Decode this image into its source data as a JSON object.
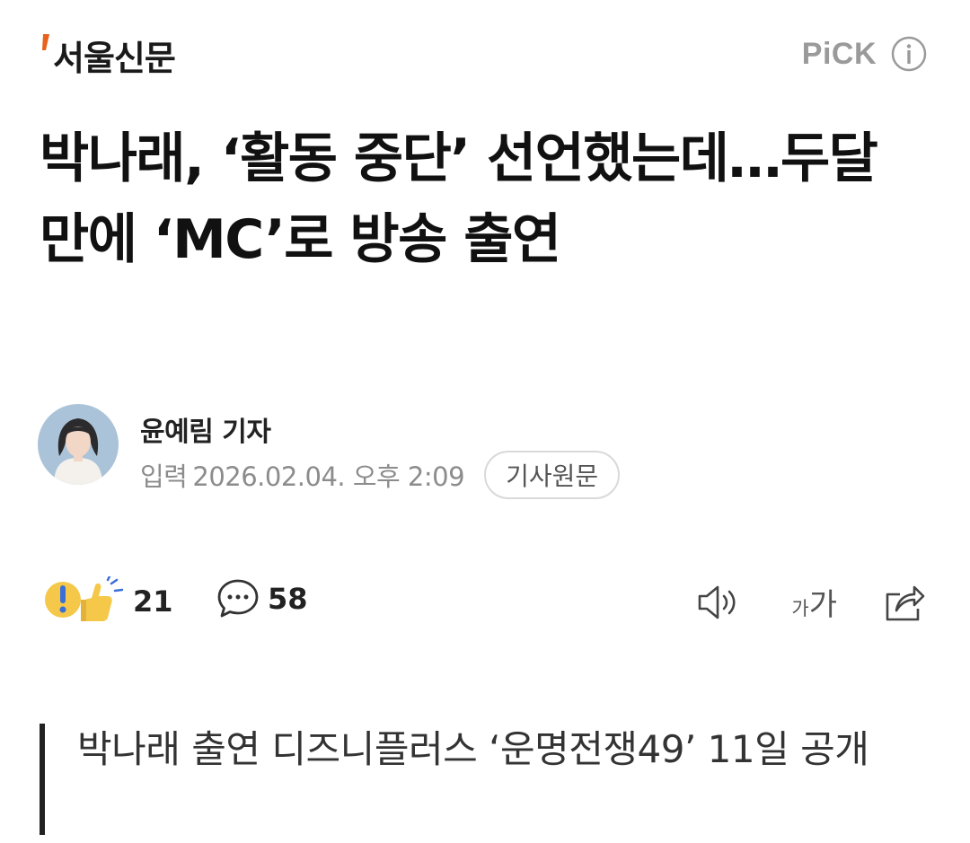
{
  "header": {
    "publisher": "서울신문",
    "pick_label": "PiCK",
    "logo_accent_color": "#e8601c"
  },
  "article": {
    "headline": "박나래, ‘활동 중단’ 선언했는데…두달 만에 ‘MC’로 방송 출연",
    "reporter": "윤예림 기자",
    "date_label": "입력",
    "date_value": "2026.02.04. 오후 2:09",
    "original_button": "기사원문",
    "subheading": "박나래 출연 디즈니플러스 ‘운명전쟁49’ 11일 공개"
  },
  "actions": {
    "reaction_count": "21",
    "comment_count": "58",
    "font_small": "가",
    "font_large": "가",
    "icons": [
      "reaction-icon",
      "comment-icon",
      "speaker-icon",
      "share-icon"
    ]
  }
}
